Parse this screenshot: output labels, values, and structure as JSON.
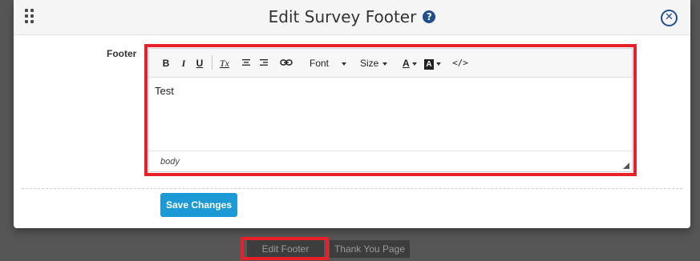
{
  "modal": {
    "title": "Edit Survey Footer",
    "help_icon": "?",
    "close_icon": "✕"
  },
  "form": {
    "footer_label": "Footer"
  },
  "toolbar": {
    "bold": "B",
    "italic": "I",
    "underline": "U",
    "clear_format": "Tx",
    "font_label": "Font",
    "size_label": "Size",
    "text_color": "A",
    "bg_color": "A",
    "source": "</>"
  },
  "editor": {
    "content": "Test",
    "status_path": "body"
  },
  "actions": {
    "save_label": "Save Changes"
  },
  "tabs": [
    {
      "label": "Edit Footer"
    },
    {
      "label": "Thank You Page"
    }
  ],
  "colors": {
    "accent": "#1b9ad6",
    "brand_navy": "#1f4e8c",
    "highlight": "#e8202a"
  }
}
